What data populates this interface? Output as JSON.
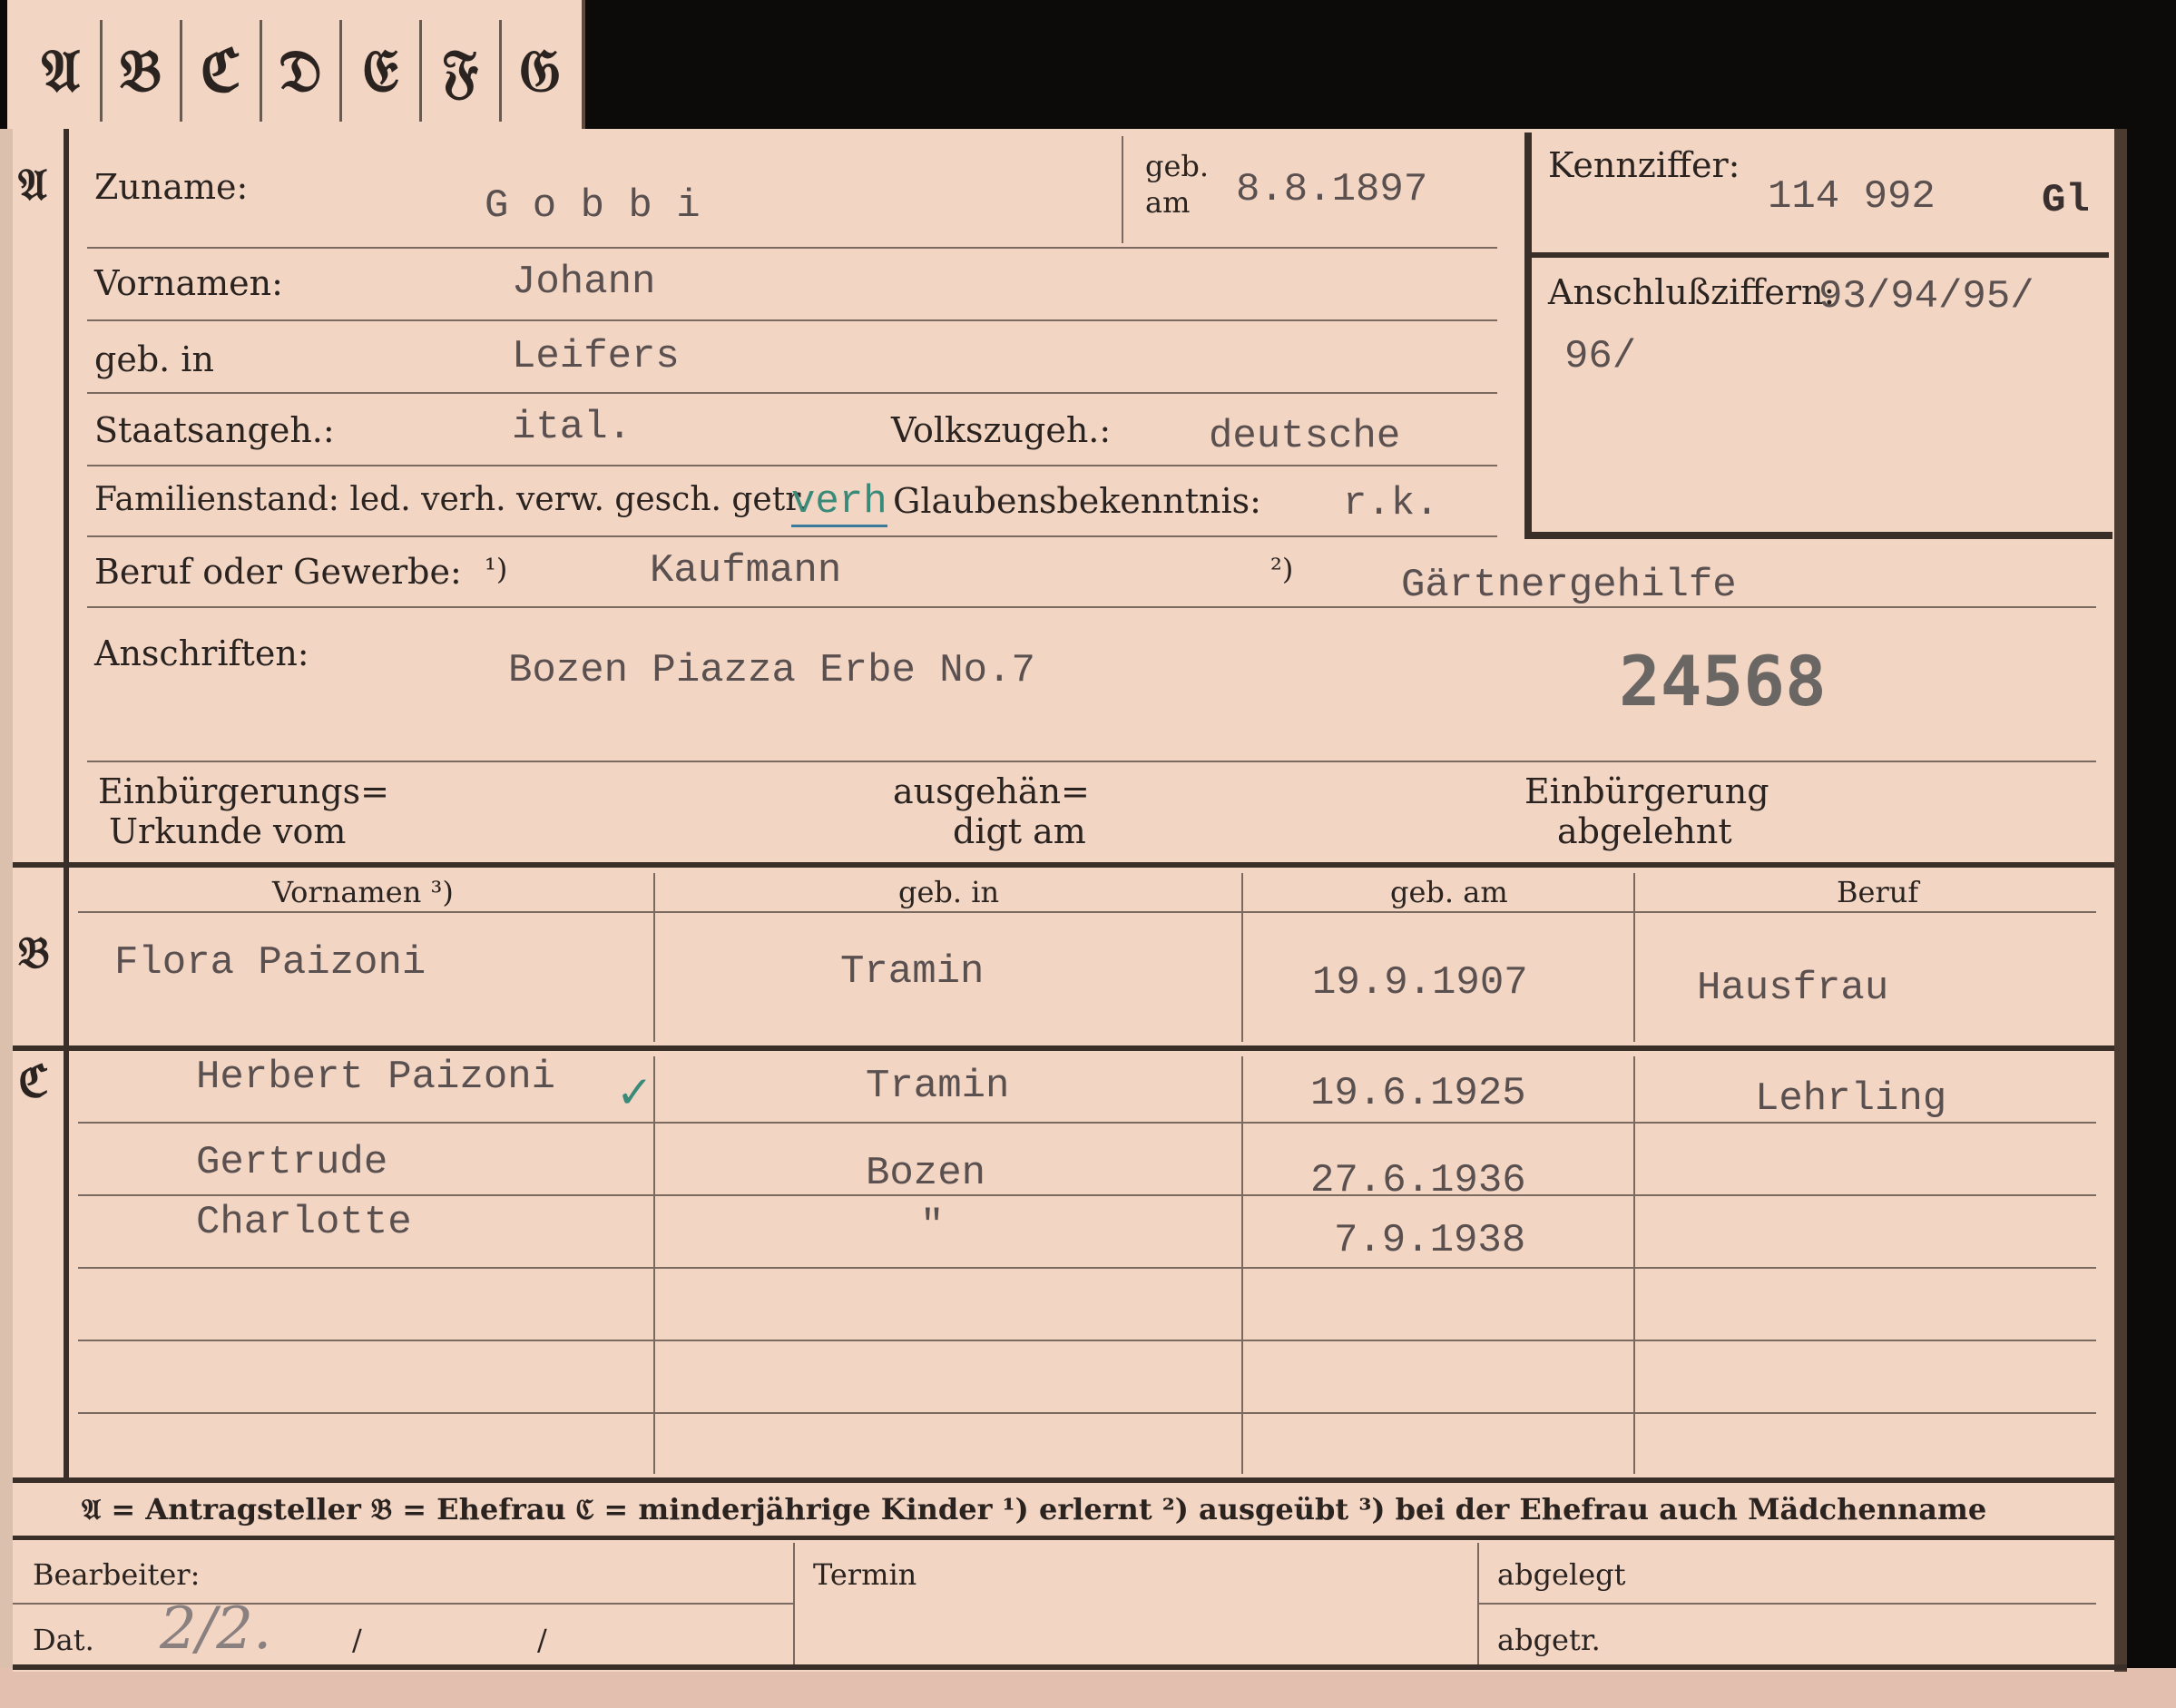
{
  "tabs": [
    "𝔄",
    "𝔅",
    "ℭ",
    "𝔇",
    "𝔈",
    "𝔉",
    "𝔊"
  ],
  "sections": {
    "a": "𝔄",
    "b": "𝔅",
    "c": "ℭ"
  },
  "applicant": {
    "zuname_label": "Zuname:",
    "zuname_value": "G o b b i",
    "geb_am_label_1": "geb.",
    "geb_am_label_2": "am",
    "geb_am_value": "8.8.1897",
    "vornamen_label": "Vornamen:",
    "vornamen_value": "Johann",
    "geb_in_label": "geb. in",
    "geb_in_value": "Leifers",
    "staatsangeh_label": "Staatsangeh.:",
    "staatsangeh_value": "ital.",
    "volkszugeh_label": "Volkszugeh.:",
    "volkszugeh_value": "deutsche",
    "familienstand_label": "Familienstand: led. verh. verw. gesch. getr.",
    "familienstand_value": "verh",
    "glaubens_label": "Glaubensbekenntnis:",
    "glaubens_value": "r.k.",
    "beruf_label": "Beruf oder Gewerbe:",
    "beruf_note_1": "¹)",
    "beruf_value_1": "Kaufmann",
    "beruf_note_2": "²)",
    "beruf_value_2": "Gärtnergehilfe",
    "anschriften_label": "Anschriften:",
    "anschriften_value": "Bozen Piazza Erbe No.7",
    "stamp_number": "24568",
    "einb_urkunde_1": "Einbürgerungs=",
    "einb_urkunde_2": "Urkunde vom",
    "ausgehaendigt_1": "ausgehän=",
    "ausgehaendigt_2": "digt am",
    "einb_abgelehnt_1": "Einbürgerung",
    "einb_abgelehnt_2": "abgelehnt"
  },
  "kennziffer": {
    "label": "Kennziffer:",
    "value": "114 992",
    "suffix": "Gl",
    "anschluss_label": "Anschlußziffern:",
    "anschluss_value_1": "93/94/95/",
    "anschluss_value_2": "96/"
  },
  "wife_table": {
    "headers": [
      "Vornamen ³)",
      "geb. in",
      "geb. am",
      "Beruf"
    ],
    "row": [
      "Flora Paizoni",
      "Tramin",
      "19.9.1907",
      "Hausfrau"
    ]
  },
  "children": [
    {
      "name": "Herbert Paizoni",
      "mark": "✓",
      "place": "Tramin",
      "date": "19.6.1925",
      "job": "Lehrling"
    },
    {
      "name": "Gertrude",
      "place": "Bozen",
      "date": "27.6.1936",
      "job": ""
    },
    {
      "name": "Charlotte",
      "place": "\"",
      "date": "7.9.1938",
      "job": ""
    }
  ],
  "legend": "𝔄 = Antragsteller   𝔅 = Ehefrau   ℭ = minderjährige Kinder   ¹) erlernt   ²) ausgeübt   ³) bei der Ehefrau auch Mädchenname",
  "footer": {
    "bearbeiter_label": "Bearbeiter:",
    "dat_label": "Dat.",
    "dat_value": "2/2.",
    "slash_1": "/",
    "slash_2": "/",
    "termin_label": "Termin",
    "abgelegt_label": "abgelegt",
    "abgetr_label": "abgetr."
  }
}
